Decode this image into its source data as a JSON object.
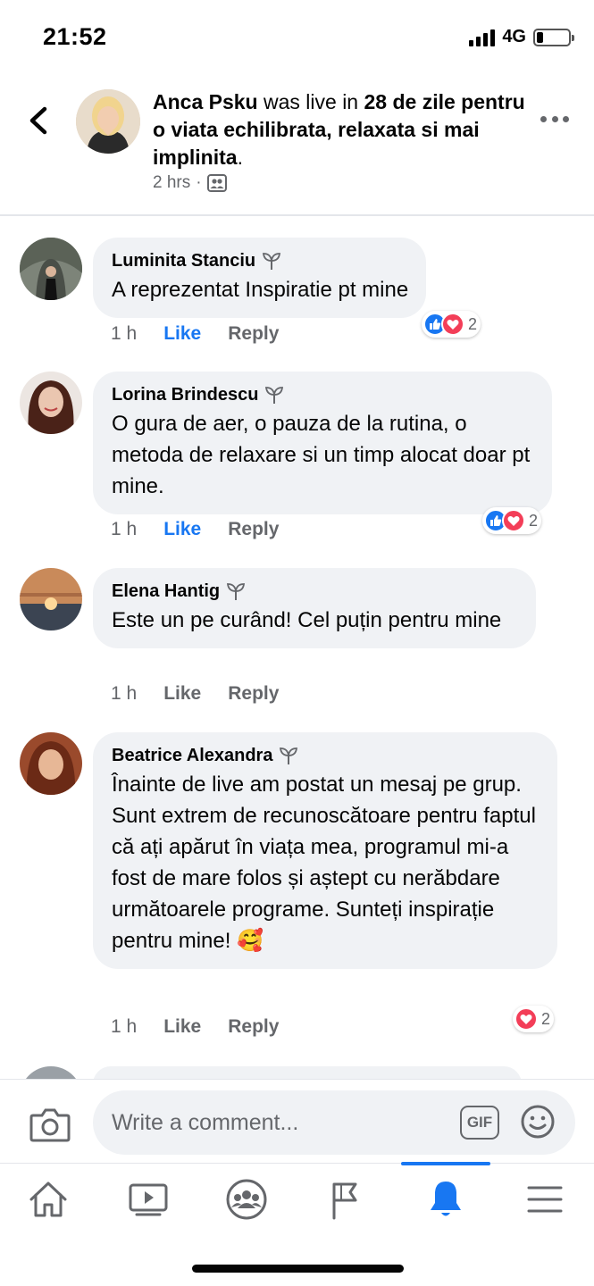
{
  "status_bar": {
    "time": "21:52",
    "network": "4G",
    "battery_level": 0.2
  },
  "header": {
    "author": "Anca Psku",
    "action": " was live in ",
    "group": "28 de zile pentru o viata echilibrata, relaxata si mai implinita",
    "suffix": ".",
    "time": "2 hrs",
    "separator": "·",
    "privacy_icon": "group-members-icon"
  },
  "comments": [
    {
      "name": "Luminita Stanciu",
      "text": "A reprezentat Inspiratie pt mine",
      "time": "1 h",
      "like_label": "Like",
      "reply_label": "Reply",
      "liked": true,
      "reactions": [
        "like",
        "love"
      ],
      "reaction_count": "2"
    },
    {
      "name": "Lorina Brindescu",
      "text": "O gura de aer, o pauza de la rutina, o metoda de relaxare si un timp alocat doar pt mine.",
      "time": "1 h",
      "like_label": "Like",
      "reply_label": "Reply",
      "liked": true,
      "reactions": [
        "like",
        "love"
      ],
      "reaction_count": "2"
    },
    {
      "name": "Elena Hantig",
      "text": "Este un pe curând! Cel puțin pentru mine",
      "time": "1 h",
      "like_label": "Like",
      "reply_label": "Reply",
      "liked": false
    },
    {
      "name": "Beatrice Alexandra",
      "text": "Înainte de live am postat un mesaj pe grup. Sunt extrem de recunoscătoare pentru faptul că ați apărut în viața mea, programul mi-a fost de mare folos și aștept cu nerăbdare următoarele programe. Sunteți inspirație pentru mine! 🥰",
      "time": "1 h",
      "like_label": "Like",
      "reply_label": "Reply",
      "liked": false,
      "reactions": [
        "love"
      ],
      "reaction_count": "2"
    }
  ],
  "composer": {
    "placeholder": "Write a comment...",
    "gif_label": "GIF"
  },
  "bottom_nav": {
    "items": [
      "home-icon",
      "watch-icon",
      "groups-icon",
      "pages-icon",
      "notifications-icon",
      "menu-icon"
    ],
    "active": "notifications-icon"
  },
  "colors": {
    "accent": "#1877f2",
    "love": "#f33e58",
    "bubble": "#f0f2f5",
    "muted": "#65676b"
  }
}
